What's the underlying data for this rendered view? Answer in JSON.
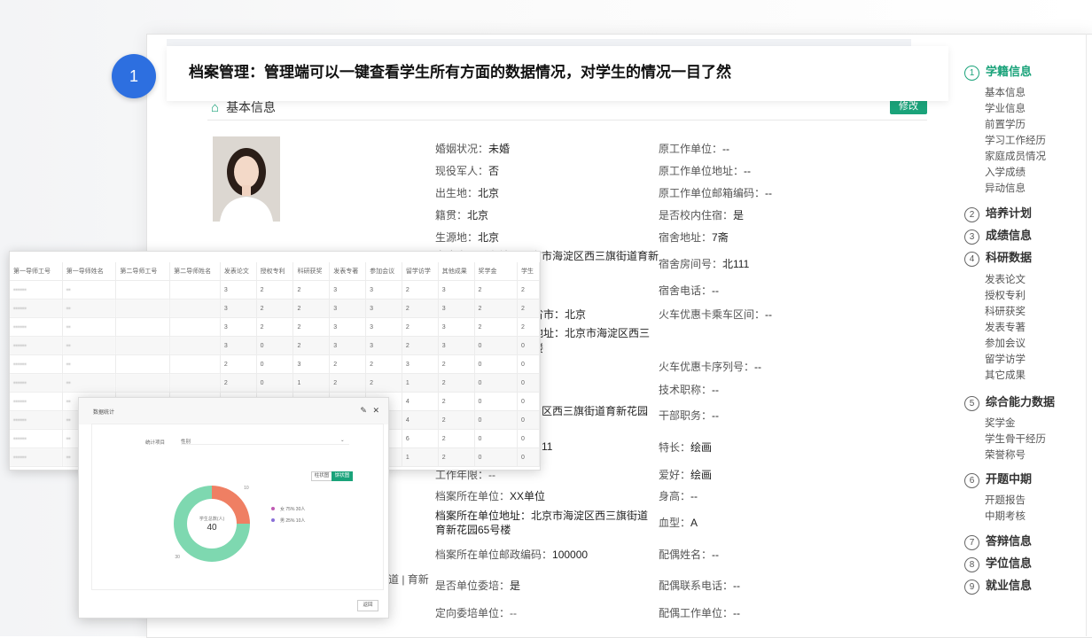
{
  "banner": {
    "badge": "1",
    "text": "档案管理：管理端可以一键查看学生所有方面的数据情况，对学生的情况一目了然"
  },
  "section": {
    "title": "基本信息",
    "edit_label": "修改"
  },
  "colors": {
    "accent": "#1aa37a",
    "badge": "#2d6fe0",
    "donut_male": "#7ed8b0",
    "donut_female": "#ef7f63"
  },
  "profile_mid": [
    {
      "label": "婚姻状况：",
      "value": "未婚"
    },
    {
      "label": "现役军人：",
      "value": "否"
    },
    {
      "label": "出生地：",
      "value": "北京"
    },
    {
      "label": "籍贯：",
      "value": "北京"
    },
    {
      "label": "生源地：",
      "value": "北京"
    },
    {
      "label": "宿舍电话：",
      "value": "--"
    }
  ],
  "profile_mid_partial": {
    "hukou": "宗庭户口所在地：北京市海淀区西三旗街道育新",
    "province": "省市：北京",
    "addr1": "地址：北京市海淀区西三",
    "addr1b": "楼",
    "addr2": "区西三旗街道育新花园",
    "num": "11",
    "work_years": "工作年限：--",
    "dang_unit": {
      "label": "档案所在单位：",
      "value": "XX单位"
    },
    "dang_addr": "档案所在单位地址：北京市海淀区西三旗街道育新花园65号楼",
    "dang_post": {
      "label": "档案所在单位邮政编码：",
      "value": "100000"
    },
    "weipei": {
      "label": "是否单位委培：",
      "value": "是"
    },
    "dingxiang": "定向委培单位：--",
    "left_frag": "道 | 育新"
  },
  "profile_right": [
    {
      "label": "原工作单位：",
      "value": "--"
    },
    {
      "label": "原工作单位地址：",
      "value": "--"
    },
    {
      "label": "原工作单位邮箱编码：",
      "value": "--"
    },
    {
      "label": "是否校内住宿：",
      "value": "是"
    },
    {
      "label": "宿舍地址：",
      "value": "7斋"
    },
    {
      "label": "宿舍房间号：",
      "value": "北111"
    },
    {
      "label": "宿舍电话：",
      "value": "--"
    },
    {
      "label": "火车优惠卡乘车区间：",
      "value": "--"
    },
    {
      "label": "火车优惠卡序列号：",
      "value": "--"
    },
    {
      "label": "技术职称：",
      "value": "--"
    },
    {
      "label": "干部职务：",
      "value": "--"
    },
    {
      "label": "特长：",
      "value": "绘画"
    },
    {
      "label": "爱好：",
      "value": "绘画"
    },
    {
      "label": "身高：",
      "value": "--"
    },
    {
      "label": "血型：",
      "value": "A"
    },
    {
      "label": "配偶姓名：",
      "value": "--"
    },
    {
      "label": "配偶联系电话：",
      "value": "--"
    },
    {
      "label": "配偶工作单位：",
      "value": "--"
    }
  ],
  "nav": [
    {
      "num": "①",
      "label": "学籍信息",
      "active": true,
      "subs": [
        "基本信息",
        "学业信息",
        "前置学历",
        "学习工作经历",
        "家庭成员情况",
        "入学成绩",
        "异动信息"
      ]
    },
    {
      "num": "②",
      "label": "培养计划",
      "subs": []
    },
    {
      "num": "③",
      "label": "成绩信息",
      "subs": []
    },
    {
      "num": "④",
      "label": "科研数据",
      "subs": [
        "发表论文",
        "授权专利",
        "科研获奖",
        "发表专著",
        "参加会议",
        "留学访学",
        "其它成果"
      ]
    },
    {
      "num": "⑤",
      "label": "综合能力数据",
      "subs": [
        "奖学金",
        "学生骨干经历",
        "荣誉称号"
      ]
    },
    {
      "num": "⑥",
      "label": "开题中期",
      "subs": [
        "开题报告",
        "中期考核"
      ]
    },
    {
      "num": "⑦",
      "label": "答辩信息",
      "subs": []
    },
    {
      "num": "⑧",
      "label": "学位信息",
      "subs": []
    },
    {
      "num": "⑨",
      "label": "就业信息",
      "subs": []
    }
  ],
  "table": {
    "headers": [
      "第一导师工号",
      "第一导师姓名",
      "第二导师工号",
      "第二导师姓名",
      "发表论文",
      "授权专利",
      "科研获奖",
      "发表专著",
      "参加会议",
      "留学访学",
      "其他成果",
      "奖学金",
      "学生"
    ],
    "rows": [
      [
        "3",
        "2",
        "2",
        "3",
        "3",
        "2",
        "3",
        "2",
        "2"
      ],
      [
        "3",
        "2",
        "2",
        "3",
        "3",
        "2",
        "3",
        "2",
        "2"
      ],
      [
        "3",
        "2",
        "2",
        "3",
        "3",
        "2",
        "3",
        "2",
        "2"
      ],
      [
        "3",
        "0",
        "2",
        "3",
        "3",
        "2",
        "3",
        "0",
        "0"
      ],
      [
        "2",
        "0",
        "3",
        "2",
        "2",
        "3",
        "2",
        "0",
        "0"
      ],
      [
        "2",
        "0",
        "1",
        "2",
        "2",
        "1",
        "2",
        "0",
        "0"
      ],
      [
        "",
        "",
        "",
        "",
        "",
        "4",
        "2",
        "0",
        "0"
      ],
      [
        "",
        "",
        "",
        "",
        "",
        "4",
        "2",
        "0",
        "0"
      ],
      [
        "",
        "",
        "",
        "",
        "",
        "6",
        "2",
        "0",
        "0"
      ],
      [
        "",
        "",
        "",
        "",
        "",
        "1",
        "2",
        "0",
        "0"
      ]
    ]
  },
  "stats": {
    "title": "数据统计",
    "field_label": "统计项目",
    "field_value": "性别",
    "toggle1": "柱状图",
    "toggle2": "饼状图",
    "center_label": "学生总数(人)",
    "center_value": "40",
    "return_label": "返回",
    "chart_data": {
      "type": "pie",
      "categories": [
        "女",
        "男"
      ],
      "values": [
        10,
        30
      ],
      "percents": [
        "75%",
        "25%"
      ],
      "legend_counts": [
        "30人",
        "10人"
      ],
      "outer_labels": [
        "10",
        "30"
      ]
    }
  }
}
